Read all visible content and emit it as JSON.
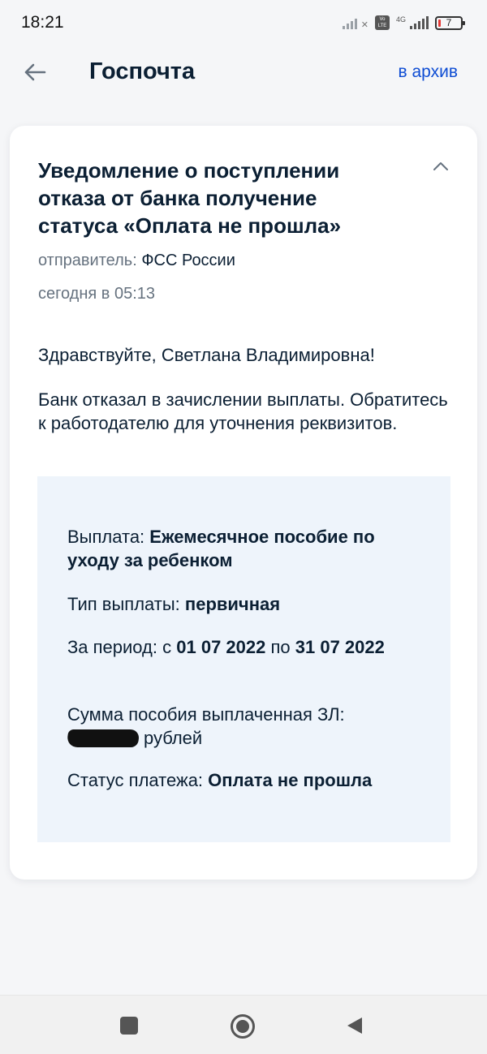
{
  "status_bar": {
    "time": "18:21",
    "volte_label": "Vo LTE",
    "network": "4G",
    "battery": "7"
  },
  "header": {
    "title": "Госпочта",
    "archive_label": "в архив"
  },
  "message": {
    "subject": "Уведомление о поступлении отказа от банка получение статуса «Оплата не прошла»",
    "sender_label": "отправитель:",
    "sender": "ФСС России",
    "date": "сегодня в 05:13",
    "greeting": "Здравствуйте, Светлана Владимировна!",
    "body": "Банк отказал в зачислении выплаты. Обратитесь к работодателю для уточнения реквизитов.",
    "details": {
      "payment_label": "Выплата:",
      "payment_value": "Ежемесячное пособие по уходу за ребенком",
      "type_label": "Тип выплаты:",
      "type_value": "первичная",
      "period_label": "За период: с",
      "period_from": "01 07 2022",
      "period_to_label": "по",
      "period_to": "31 07 2022",
      "amount_label": "Сумма пособия выплаченная ЗЛ:",
      "amount_unit": "рублей",
      "status_label": "Статус платежа:",
      "status_value": "Оплата не прошла"
    }
  },
  "colors": {
    "accent": "#0d4cd3",
    "text": "#0b1f33",
    "muted": "#66727f",
    "info_bg": "#eef4fb",
    "page_bg": "#f5f6f8"
  }
}
